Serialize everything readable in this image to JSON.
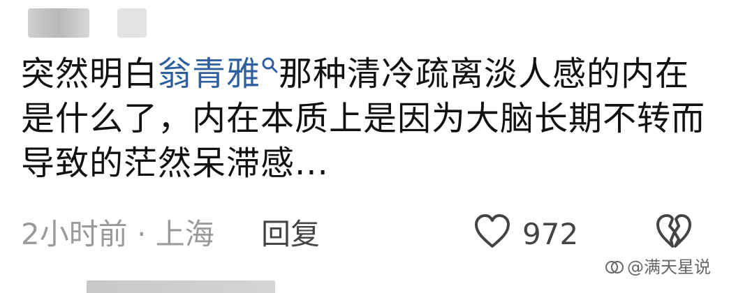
{
  "comment": {
    "text_before": "突然明白",
    "link_text": "翁青雅",
    "text_after": "那种清冷疏离淡人感的内在是什么了，内在本质上是因为大脑长期不转而导致的茫然呆滞感..."
  },
  "meta": {
    "time_location": "2小时前 · 上海",
    "reply_label": "回复"
  },
  "likes": {
    "count": "972"
  },
  "watermark": {
    "text": "@满天星说"
  },
  "icons": {
    "search": "search-icon",
    "like": "heart-outline-icon",
    "dislike": "broken-heart-icon",
    "watermark_logo": "watermark-logo-icon"
  },
  "colors": {
    "link": "#2f5f9e",
    "meta_text": "#9a9a9a",
    "icon_stroke": "#444444"
  }
}
